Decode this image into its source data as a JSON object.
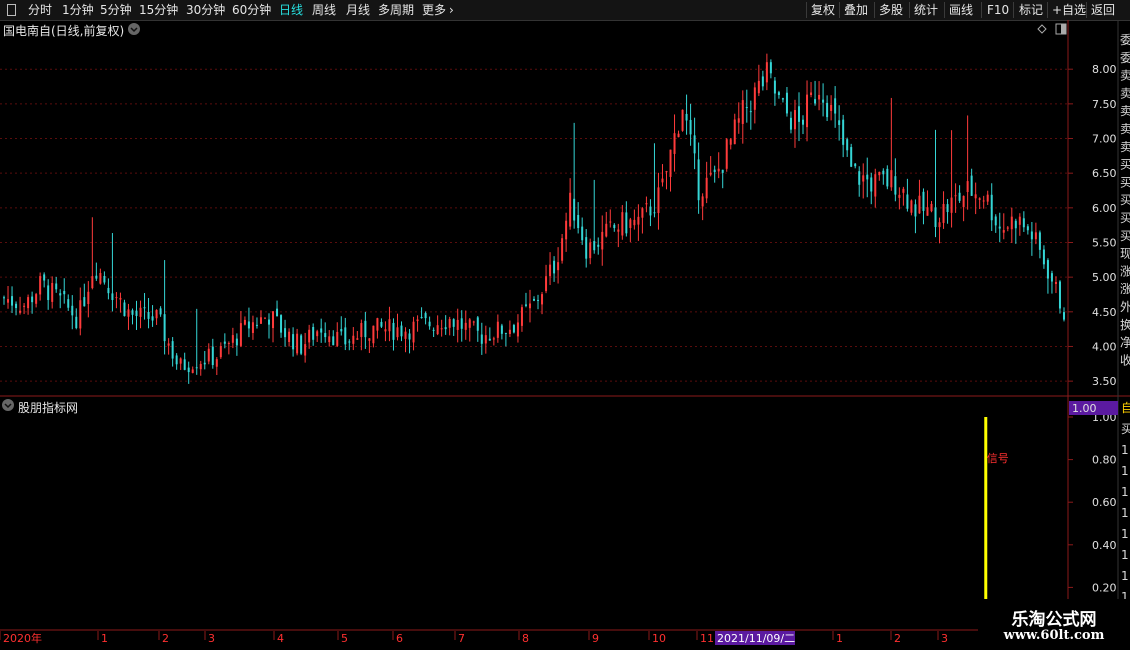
{
  "toolbar": {
    "menu_icon": "window-menu-icon",
    "left_items": [
      "分时",
      "1分钟",
      "5分钟",
      "15分钟",
      "30分钟",
      "60分钟",
      "日线",
      "周线",
      "月线",
      "多周期",
      "更多"
    ],
    "active_item": "日线",
    "more_icon": "chevron-right-icon",
    "right_items": [
      "复权",
      "叠加",
      "多股",
      "统计",
      "画线",
      "F10",
      "标记",
      "+自选",
      "返回"
    ]
  },
  "chart_header": {
    "title": "国电南自(日线,前复权)",
    "dropdown_icon": "chevron-down-icon",
    "diamond_icon": "diamond-icon",
    "layout_icon": "panel-toggle-icon"
  },
  "indicator_header": {
    "title": "股朋指标网",
    "dropdown_icon": "chevron-down-icon",
    "signal_label": "信号",
    "current_value": "1.00"
  },
  "x_axis": {
    "labels": [
      "2020年",
      "1",
      "2",
      "3",
      "4",
      "5",
      "6",
      "7",
      "8",
      "9",
      "10",
      "11",
      "2021/11/09/二",
      "1",
      "2",
      "3"
    ],
    "highlight_label": "2021/11/09/二"
  },
  "side_panel": {
    "glyphs": [
      "委",
      "委",
      "卖",
      "卖",
      "卖",
      "卖",
      "卖",
      "买",
      "买",
      "买",
      "买",
      "买",
      "现",
      "涨",
      "涨",
      "外",
      "换",
      "净",
      "收"
    ],
    "indicator_glyphs": [
      "自",
      "买",
      "1",
      "1",
      "1",
      "1",
      "1",
      "1",
      "1",
      "1"
    ]
  },
  "watermark": {
    "line1": "乐淘公式网",
    "line2": "www.60lt.com"
  },
  "colors": {
    "up": "#ff3b3b",
    "down": "#35d6d6",
    "grid": "#5a0d0d",
    "signal_bar": "#ffff00",
    "value_badge": "#5b1aa0",
    "highlight_date_bg": "#5b1aa0",
    "active_tab": "#27e0e0"
  },
  "chart_data": [
    {
      "type": "candlestick",
      "title": "国电南自(日线,前复权)",
      "price_axis_ticks": [
        8.0,
        7.5,
        7.0,
        6.5,
        6.0,
        5.5,
        5.0,
        4.5,
        4.0,
        3.5
      ],
      "ylim": [
        3.3,
        8.45
      ],
      "x_labels": [
        "2020年",
        "1",
        "2",
        "3",
        "4",
        "5",
        "6",
        "7",
        "8",
        "9",
        "10",
        "11",
        "2021/11/09/二",
        "1",
        "2",
        "3"
      ],
      "close_path_points": [
        [
          0,
          4.7
        ],
        [
          0.02,
          4.6
        ],
        [
          0.035,
          4.9
        ],
        [
          0.05,
          4.7
        ],
        [
          0.07,
          4.4
        ],
        [
          0.085,
          5.2
        ],
        [
          0.1,
          4.85
        ],
        [
          0.12,
          4.45
        ],
        [
          0.145,
          4.4
        ],
        [
          0.165,
          3.7
        ],
        [
          0.18,
          3.8
        ],
        [
          0.2,
          3.85
        ],
        [
          0.23,
          4.3
        ],
        [
          0.25,
          4.45
        ],
        [
          0.265,
          4.2
        ],
        [
          0.28,
          4.0
        ],
        [
          0.3,
          4.3
        ],
        [
          0.32,
          4.05
        ],
        [
          0.345,
          4.25
        ],
        [
          0.38,
          4.25
        ],
        [
          0.42,
          4.4
        ],
        [
          0.45,
          4.15
        ],
        [
          0.48,
          4.3
        ],
        [
          0.5,
          4.6
        ],
        [
          0.52,
          5.2
        ],
        [
          0.535,
          6.1
        ],
        [
          0.55,
          5.4
        ],
        [
          0.58,
          5.75
        ],
        [
          0.6,
          5.8
        ],
        [
          0.62,
          6.2
        ],
        [
          0.64,
          7.5
        ],
        [
          0.655,
          6.3
        ],
        [
          0.67,
          6.4
        ],
        [
          0.7,
          7.45
        ],
        [
          0.72,
          7.9
        ],
        [
          0.735,
          7.4
        ],
        [
          0.75,
          7.2
        ],
        [
          0.77,
          7.8
        ],
        [
          0.785,
          7.2
        ],
        [
          0.8,
          6.5
        ],
        [
          0.82,
          6.35
        ],
        [
          0.84,
          6.4
        ],
        [
          0.86,
          6.0
        ],
        [
          0.88,
          5.9
        ],
        [
          0.91,
          6.25
        ],
        [
          0.925,
          6.2
        ],
        [
          0.94,
          5.7
        ],
        [
          0.955,
          5.85
        ],
        [
          0.97,
          5.6
        ],
        [
          0.985,
          5.1
        ],
        [
          1.0,
          4.5
        ]
      ]
    },
    {
      "type": "indicator",
      "title": "股朋指标网",
      "y_axis_ticks": [
        0.2,
        0.4,
        0.6,
        0.8,
        1.0
      ],
      "ylim": [
        0,
        1.0
      ],
      "signal_date_fraction": 0.923,
      "signal_value": 1.0,
      "signal_label": "信号"
    }
  ]
}
